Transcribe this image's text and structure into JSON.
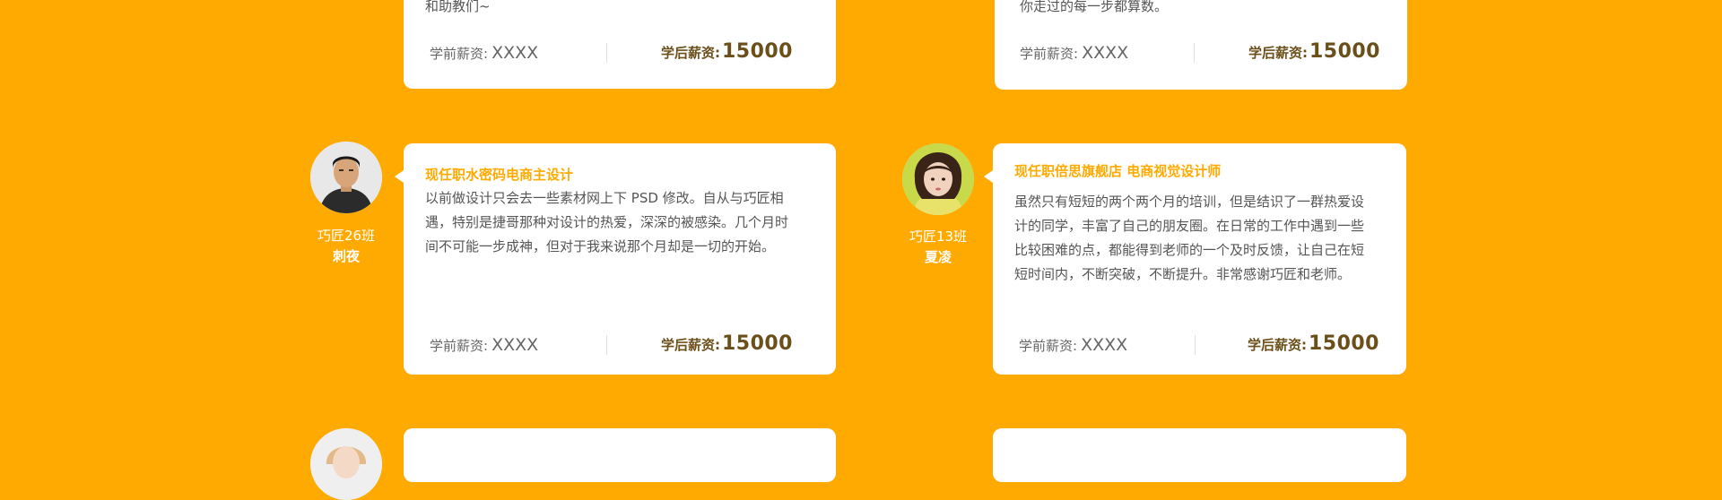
{
  "testimonials": [
    {
      "title": "",
      "body": "和助教们~",
      "salary_before_label": "学前薪资:",
      "salary_before_value": "XXXX",
      "salary_after_label": "学后薪资:",
      "salary_after_value": "15000"
    },
    {
      "title": "",
      "body": "你走过的每一步都算数。",
      "salary_before_label": "学前薪资:",
      "salary_before_value": "XXXX",
      "salary_after_label": "学后薪资:",
      "salary_after_value": "15000"
    },
    {
      "title": "现任职水密码电商主设计",
      "body": "以前做设计只会去一些素材网上下 PSD 修改。自从与巧匠相遇，特别是捷哥那种对设计的热爱，深深的被感染。几个月时间不可能一步成神，但对于我来说那个月却是一切的开始。",
      "salary_before_label": "学前薪资:",
      "salary_before_value": "XXXX",
      "salary_after_label": "学后薪资:",
      "salary_after_value": "15000",
      "student_class": "巧匠26班",
      "student_name": "刺夜",
      "avatar_icon": "student-avatar-icon"
    },
    {
      "title": "现任职倍思旗舰店 电商视觉设计师",
      "body": "虽然只有短短的两个两个月的培训，但是结识了一群热爱设计的同学，丰富了自己的朋友圈。在日常的工作中遇到一些比较困难的点，都能得到老师的一个及时反馈，让自己在短短时间内，不断突破，不断提升。非常感谢巧匠和老师。",
      "salary_before_label": "学前薪资:",
      "salary_before_value": "XXXX",
      "salary_after_label": "学后薪资:",
      "salary_after_value": "15000",
      "student_class": "巧匠13班",
      "student_name": "夏凌",
      "avatar_icon": "student-avatar-icon"
    }
  ],
  "colors": {
    "background": "#FFAA00",
    "accent": "#FFAA00",
    "card": "#FFFFFF",
    "salary_after": "#6B4F1A"
  }
}
